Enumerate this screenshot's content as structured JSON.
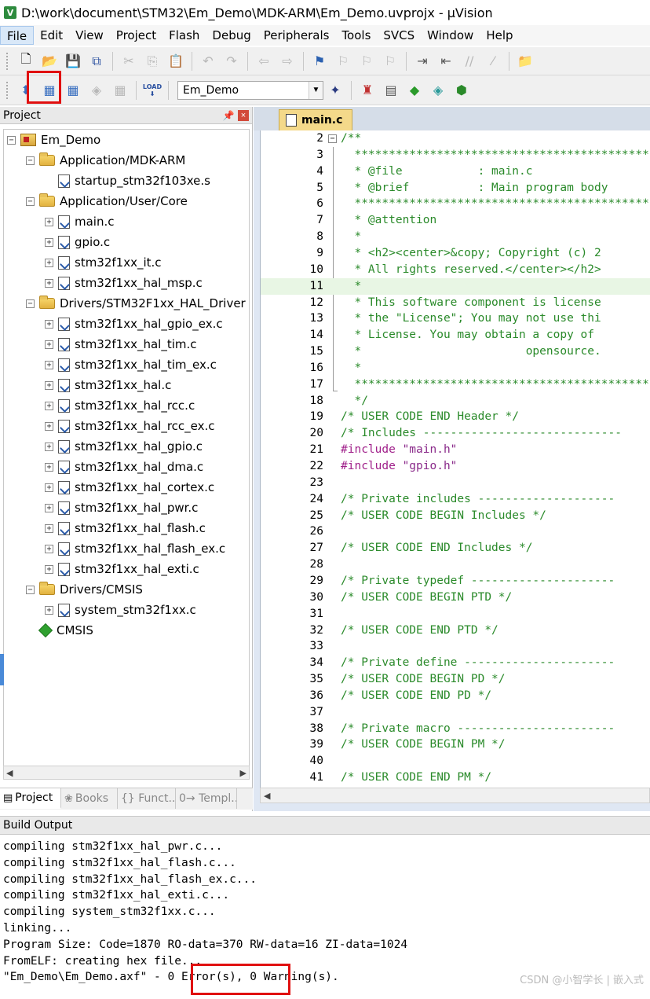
{
  "window": {
    "title": "D:\\work\\document\\STM32\\Em_Demo\\MDK-ARM\\Em_Demo.uvprojx - µVision",
    "app_icon": "V"
  },
  "menu": [
    "File",
    "Edit",
    "View",
    "Project",
    "Flash",
    "Debug",
    "Peripherals",
    "Tools",
    "SVCS",
    "Window",
    "Help"
  ],
  "toolbar2": {
    "target": "Em_Demo",
    "load_label": "LOAD"
  },
  "project_panel": {
    "title": "Project",
    "pin": "ᵖ",
    "close": "×",
    "tree": [
      {
        "label": "Em_Demo",
        "type": "project",
        "level": 0,
        "expander": "−"
      },
      {
        "label": "Application/MDK-ARM",
        "type": "folder",
        "level": 1,
        "expander": "−"
      },
      {
        "label": "startup_stm32f103xe.s",
        "type": "file",
        "level": 2,
        "expander": ""
      },
      {
        "label": "Application/User/Core",
        "type": "folder",
        "level": 1,
        "expander": "−"
      },
      {
        "label": "main.c",
        "type": "file",
        "level": 2,
        "expander": "+"
      },
      {
        "label": "gpio.c",
        "type": "file",
        "level": 2,
        "expander": "+"
      },
      {
        "label": "stm32f1xx_it.c",
        "type": "file",
        "level": 2,
        "expander": "+"
      },
      {
        "label": "stm32f1xx_hal_msp.c",
        "type": "file",
        "level": 2,
        "expander": "+"
      },
      {
        "label": "Drivers/STM32F1xx_HAL_Driver",
        "type": "folder",
        "level": 1,
        "expander": "−"
      },
      {
        "label": "stm32f1xx_hal_gpio_ex.c",
        "type": "file",
        "level": 2,
        "expander": "+"
      },
      {
        "label": "stm32f1xx_hal_tim.c",
        "type": "file",
        "level": 2,
        "expander": "+"
      },
      {
        "label": "stm32f1xx_hal_tim_ex.c",
        "type": "file",
        "level": 2,
        "expander": "+"
      },
      {
        "label": "stm32f1xx_hal.c",
        "type": "file",
        "level": 2,
        "expander": "+"
      },
      {
        "label": "stm32f1xx_hal_rcc.c",
        "type": "file",
        "level": 2,
        "expander": "+"
      },
      {
        "label": "stm32f1xx_hal_rcc_ex.c",
        "type": "file",
        "level": 2,
        "expander": "+"
      },
      {
        "label": "stm32f1xx_hal_gpio.c",
        "type": "file",
        "level": 2,
        "expander": "+"
      },
      {
        "label": "stm32f1xx_hal_dma.c",
        "type": "file",
        "level": 2,
        "expander": "+"
      },
      {
        "label": "stm32f1xx_hal_cortex.c",
        "type": "file",
        "level": 2,
        "expander": "+"
      },
      {
        "label": "stm32f1xx_hal_pwr.c",
        "type": "file",
        "level": 2,
        "expander": "+"
      },
      {
        "label": "stm32f1xx_hal_flash.c",
        "type": "file",
        "level": 2,
        "expander": "+"
      },
      {
        "label": "stm32f1xx_hal_flash_ex.c",
        "type": "file",
        "level": 2,
        "expander": "+"
      },
      {
        "label": "stm32f1xx_hal_exti.c",
        "type": "file",
        "level": 2,
        "expander": "+"
      },
      {
        "label": "Drivers/CMSIS",
        "type": "folder",
        "level": 1,
        "expander": "−"
      },
      {
        "label": "system_stm32f1xx.c",
        "type": "file",
        "level": 2,
        "expander": "+"
      },
      {
        "label": "CMSIS",
        "type": "cmsis",
        "level": 1,
        "expander": ""
      }
    ],
    "tabs": [
      {
        "label": "Project",
        "icon": "▤"
      },
      {
        "label": "Books",
        "icon": "❀"
      },
      {
        "label": "{} Funct...",
        "icon": ""
      },
      {
        "label": "0→ Templ...",
        "icon": ""
      }
    ]
  },
  "editor": {
    "tab": "main.c",
    "lines": [
      {
        "n": "2",
        "fold": "−",
        "segs": [
          {
            "t": "/**",
            "c": "c-comment"
          }
        ]
      },
      {
        "n": "3",
        "segs": [
          {
            "t": "  ******************************************************",
            "c": "c-comment"
          }
        ]
      },
      {
        "n": "4",
        "segs": [
          {
            "t": "  * @file           : main.c",
            "c": "c-comment"
          }
        ]
      },
      {
        "n": "5",
        "segs": [
          {
            "t": "  * @brief          : Main program body",
            "c": "c-comment"
          }
        ]
      },
      {
        "n": "6",
        "segs": [
          {
            "t": "  ******************************************************",
            "c": "c-comment"
          }
        ]
      },
      {
        "n": "7",
        "segs": [
          {
            "t": "  * @attention",
            "c": "c-comment"
          }
        ]
      },
      {
        "n": "8",
        "segs": [
          {
            "t": "  *",
            "c": "c-comment"
          }
        ]
      },
      {
        "n": "9",
        "segs": [
          {
            "t": "  * <h2><center>&copy; Copyright (c) 2",
            "c": "c-comment"
          }
        ]
      },
      {
        "n": "10",
        "segs": [
          {
            "t": "  * All rights reserved.</center></h2>",
            "c": "c-comment"
          }
        ]
      },
      {
        "n": "11",
        "hl": true,
        "segs": [
          {
            "t": "  *",
            "c": "c-comment"
          }
        ]
      },
      {
        "n": "12",
        "segs": [
          {
            "t": "  * This software component is license",
            "c": "c-comment"
          }
        ]
      },
      {
        "n": "13",
        "segs": [
          {
            "t": "  * the \"License\"; You may not use thi",
            "c": "c-comment"
          }
        ]
      },
      {
        "n": "14",
        "segs": [
          {
            "t": "  * License. You may obtain a copy of",
            "c": "c-comment"
          }
        ]
      },
      {
        "n": "15",
        "segs": [
          {
            "t": "  *                        opensource.",
            "c": "c-comment"
          }
        ]
      },
      {
        "n": "16",
        "segs": [
          {
            "t": "  *",
            "c": "c-comment"
          }
        ]
      },
      {
        "n": "17",
        "segs": [
          {
            "t": "  ******************************************************",
            "c": "c-comment"
          }
        ]
      },
      {
        "n": "18",
        "segs": [
          {
            "t": "  */",
            "c": "c-comment"
          }
        ]
      },
      {
        "n": "19",
        "segs": [
          {
            "t": "/* USER CODE END Header */",
            "c": "c-comment"
          }
        ]
      },
      {
        "n": "20",
        "segs": [
          {
            "t": "/* Includes -----------------------------",
            "c": "c-comment"
          }
        ]
      },
      {
        "n": "21",
        "segs": [
          {
            "t": "#include ",
            "c": "c-pp"
          },
          {
            "t": "\"main.h\"",
            "c": "c-str"
          }
        ]
      },
      {
        "n": "22",
        "segs": [
          {
            "t": "#include ",
            "c": "c-pp"
          },
          {
            "t": "\"gpio.h\"",
            "c": "c-str"
          }
        ]
      },
      {
        "n": "23",
        "segs": []
      },
      {
        "n": "24",
        "segs": [
          {
            "t": "/* Private includes --------------------",
            "c": "c-comment"
          }
        ]
      },
      {
        "n": "25",
        "segs": [
          {
            "t": "/* USER CODE BEGIN Includes */",
            "c": "c-comment"
          }
        ]
      },
      {
        "n": "26",
        "segs": []
      },
      {
        "n": "27",
        "segs": [
          {
            "t": "/* USER CODE END Includes */",
            "c": "c-comment"
          }
        ]
      },
      {
        "n": "28",
        "segs": []
      },
      {
        "n": "29",
        "segs": [
          {
            "t": "/* Private typedef ---------------------",
            "c": "c-comment"
          }
        ]
      },
      {
        "n": "30",
        "segs": [
          {
            "t": "/* USER CODE BEGIN PTD */",
            "c": "c-comment"
          }
        ]
      },
      {
        "n": "31",
        "segs": []
      },
      {
        "n": "32",
        "segs": [
          {
            "t": "/* USER CODE END PTD */",
            "c": "c-comment"
          }
        ]
      },
      {
        "n": "33",
        "segs": []
      },
      {
        "n": "34",
        "segs": [
          {
            "t": "/* Private define ----------------------",
            "c": "c-comment"
          }
        ]
      },
      {
        "n": "35",
        "segs": [
          {
            "t": "/* USER CODE BEGIN PD */",
            "c": "c-comment"
          }
        ]
      },
      {
        "n": "36",
        "segs": [
          {
            "t": "/* USER CODE END PD */",
            "c": "c-comment"
          }
        ]
      },
      {
        "n": "37",
        "segs": []
      },
      {
        "n": "38",
        "segs": [
          {
            "t": "/* Private macro -----------------------",
            "c": "c-comment"
          }
        ]
      },
      {
        "n": "39",
        "segs": [
          {
            "t": "/* USER CODE BEGIN PM */",
            "c": "c-comment"
          }
        ]
      },
      {
        "n": "40",
        "segs": []
      },
      {
        "n": "41",
        "segs": [
          {
            "t": "/* USER CODE END PM */",
            "c": "c-comment"
          }
        ]
      }
    ]
  },
  "build_output": {
    "title": "Build Output",
    "lines": [
      "compiling stm32f1xx_hal_pwr.c...",
      "compiling stm32f1xx_hal_flash.c...",
      "compiling stm32f1xx_hal_flash_ex.c...",
      "compiling stm32f1xx_hal_exti.c...",
      "compiling system_stm32f1xx.c...",
      "linking...",
      "Program Size: Code=1870 RO-data=370 RW-data=16 ZI-data=1024",
      "FromELF: creating hex file...",
      "\"Em_Demo\\Em_Demo.axf\" - 0 Error(s), 0 Warning(s)."
    ]
  },
  "watermark": "CSDN @小智学长 | 嵌入式",
  "colors": {
    "comment": "#2a8a2a",
    "preprocessor": "#a0208a",
    "highlight_box": "#e01010",
    "tab_active": "#f4d98a"
  }
}
